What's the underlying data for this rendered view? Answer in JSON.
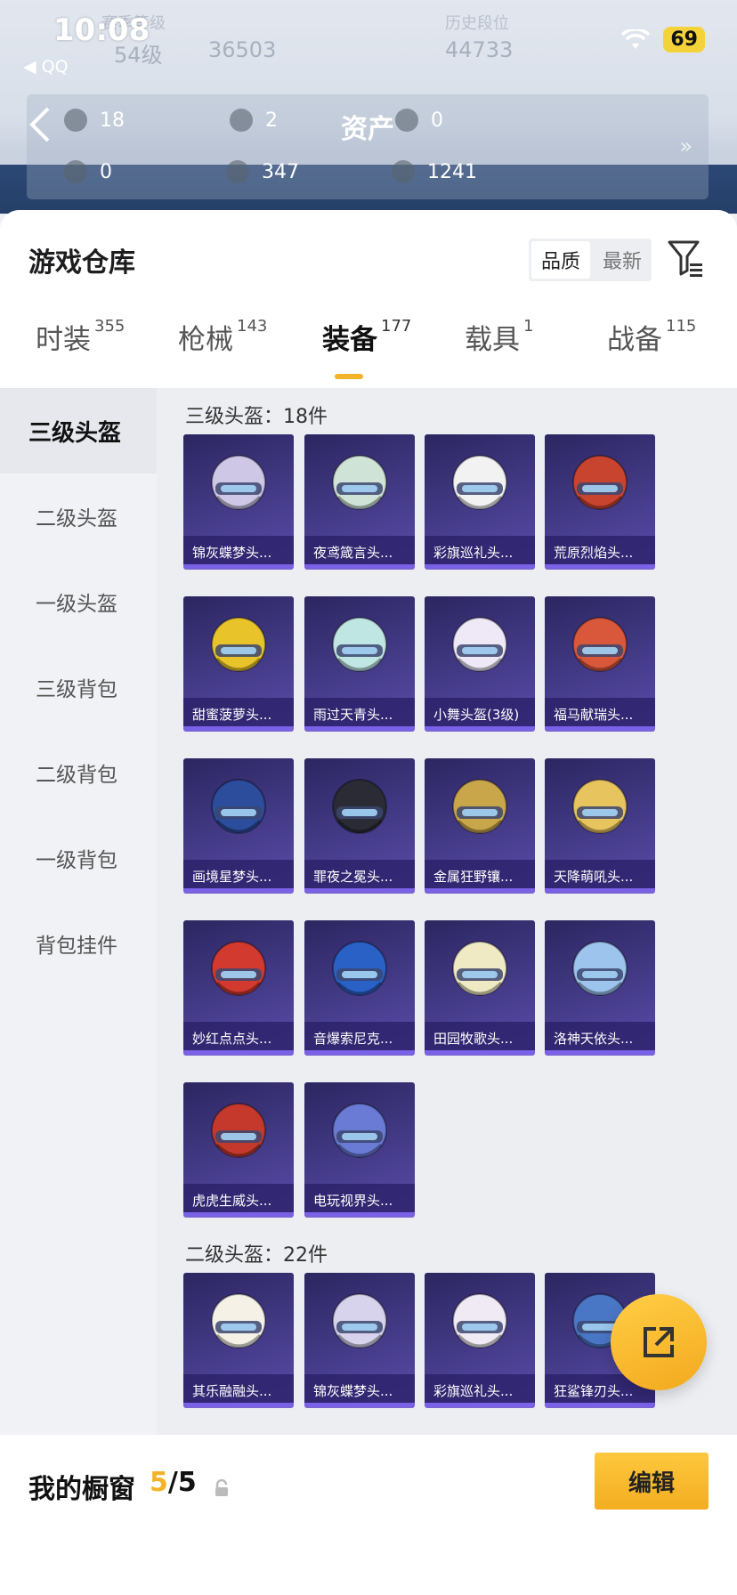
{
  "status": {
    "time": "10:08",
    "back_app": "◀ QQ",
    "battery": "69"
  },
  "top": {
    "blur_left_label": "赛季等级",
    "level": "54级",
    "coins": "36503",
    "blur_right_label": "历史段位",
    "points": "44733",
    "asset_title": "资产",
    "assets": [
      "18",
      "2",
      "0",
      "0",
      "347",
      "1241"
    ],
    "more_arrow": "»"
  },
  "header": {
    "title": "游戏仓库",
    "sort": [
      "品质",
      "最新"
    ]
  },
  "tabs": [
    {
      "label": "时装",
      "count": "355"
    },
    {
      "label": "枪械",
      "count": "143"
    },
    {
      "label": "装备",
      "count": "177"
    },
    {
      "label": "载具",
      "count": "1"
    },
    {
      "label": "战备",
      "count": "115"
    }
  ],
  "sidebar": [
    "三级头盔",
    "二级头盔",
    "一级头盔",
    "三级背包",
    "二级背包",
    "一级背包",
    "背包挂件"
  ],
  "sections": [
    {
      "title": "三级头盔：18件",
      "items": [
        "锦灰蝶梦头...",
        "夜鸢箴言头...",
        "彩旗巡礼头...",
        "荒原烈焰头...",
        "甜蜜菠萝头...",
        "雨过天青头...",
        "小舞头盔(3级)",
        "福马献瑞头...",
        "画境星梦头...",
        "罪夜之冕头...",
        "金属狂野镶...",
        "天降萌吼头...",
        "妙红点点头...",
        "音爆索尼克...",
        "田园牧歌头...",
        "洛神天依头...",
        "虎虎生威头...",
        "电玩视界头..."
      ]
    },
    {
      "title": "二级头盔：22件",
      "items": [
        "其乐融融头...",
        "锦灰蝶梦头...",
        "彩旗巡礼头...",
        "狂鲨锋刃头..."
      ]
    }
  ],
  "helmet_colors": [
    "#cfc7e6",
    "#cfe3d6",
    "#f2f2f2",
    "#c9442e",
    "#e8c42a",
    "#bfe6e2",
    "#efe8f6",
    "#d9573a",
    "#2c4c9c",
    "#2b2b36",
    "#c9a64a",
    "#e8c45e",
    "#d23a2f",
    "#2a61c6",
    "#efe9c4",
    "#9cc4ec",
    "#c5392c",
    "#6a7bd6",
    "#f5f1e6",
    "#d8d3ec",
    "#efeaf3",
    "#4a76c6"
  ],
  "showcase": {
    "label": "我的橱窗",
    "count_hi": "5",
    "count_total": "/5",
    "edit": "编辑"
  }
}
